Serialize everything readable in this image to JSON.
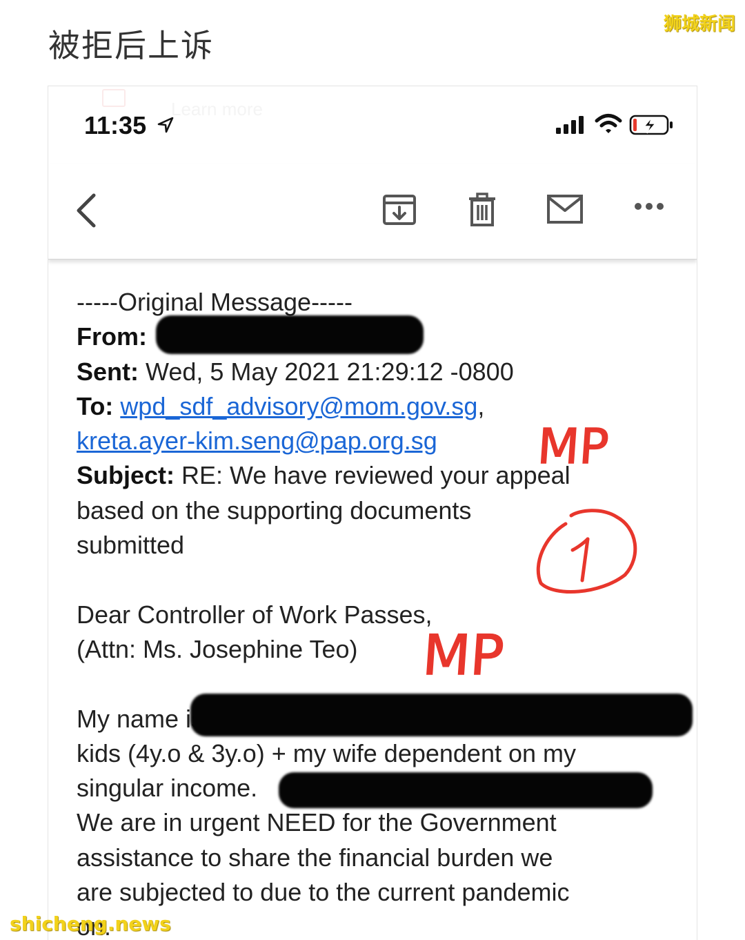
{
  "article": {
    "title": "被拒后上诉",
    "watermark_top": "狮城新闻",
    "watermark_bottom": "shicheng.news"
  },
  "status_bar": {
    "time": "11:35",
    "ghost_text": "Learn more"
  },
  "toolbar": {
    "icons": [
      "back-chevron-icon",
      "archive-icon",
      "trash-icon",
      "mail-icon",
      "more-icon"
    ]
  },
  "email": {
    "header": "-----Original Message-----",
    "from_label": "From:",
    "sent_label": "Sent:",
    "sent_value": " Wed, 5 May 2021 21:29:12 -0800",
    "to_label": "To:",
    "to_address_1": "wpd_sdf_advisory@mom.gov.sg",
    "to_separator": ",",
    "to_address_2": "kreta.ayer-kim.seng@pap.org.sg",
    "subject_label": "Subject:",
    "subject_line_1": " RE: We have reviewed your appeal",
    "subject_line_2": "based on the supporting documents",
    "subject_line_3": "submitted",
    "greeting_1": "Dear Controller of Work Passes,",
    "greeting_2": "(Attn: Ms. Josephine Teo)",
    "body_1": "My name is",
    "body_2": "kids (4y.o & 3y.o) + my wife dependent on my",
    "body_3": "singular income.",
    "body_4": "We are in urgent NEED for the Government",
    "body_5": "assistance to share the financial burden we",
    "body_6": "are subjected to due to the current pandemic",
    "body_7": "on."
  },
  "annotations": {
    "mp_mark_1": "MP",
    "mp_mark_2": "MP",
    "circled_number": "1",
    "ink_color": "#e8362c"
  }
}
